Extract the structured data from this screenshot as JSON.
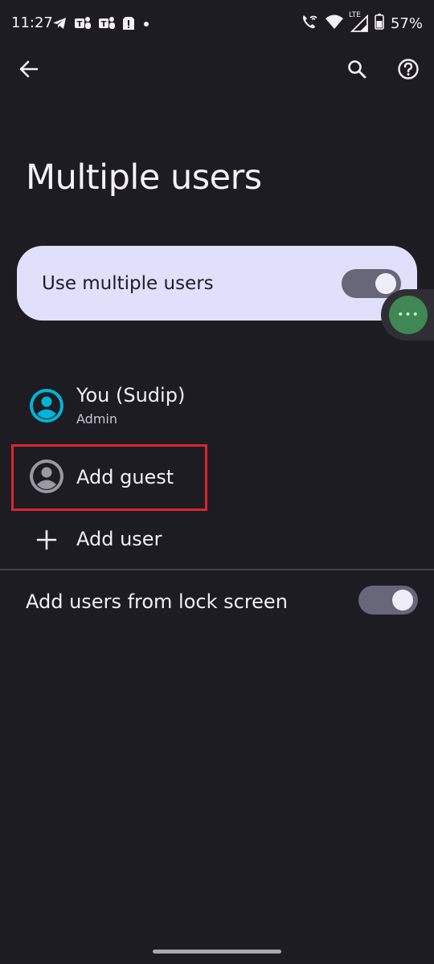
{
  "status_bar": {
    "time": "11:27",
    "battery": "57%",
    "network": "LTE",
    "left_icons": [
      "telegram-icon",
      "teams-icon",
      "teams-icon",
      "sim-alert-icon",
      "notification-dot-icon"
    ],
    "right_icons": [
      "wifi-calling-icon",
      "wifi-icon",
      "cellular-signal-icon",
      "battery-icon"
    ]
  },
  "toolbar": {
    "back_icon": "back-arrow-icon",
    "search_icon": "search-icon",
    "help_icon": "help-icon"
  },
  "page": {
    "title": "Multiple users"
  },
  "main_switch": {
    "label": "Use multiple users",
    "enabled": true
  },
  "users": {
    "you": {
      "name": "You (Sudip)",
      "role": "Admin"
    },
    "guest": {
      "label": "Add guest"
    },
    "add_user": {
      "label": "Add user"
    }
  },
  "lock_screen": {
    "label": "Add users from lock screen",
    "enabled": true
  },
  "floating_bubble": {
    "text": "•••"
  },
  "colors": {
    "background": "#1d1c22",
    "card": "#e1e0fb",
    "toggle_track": "#676779",
    "avatar_accent": "#00b4d8",
    "highlight": "#d72631",
    "bubble": "#3f8753"
  }
}
